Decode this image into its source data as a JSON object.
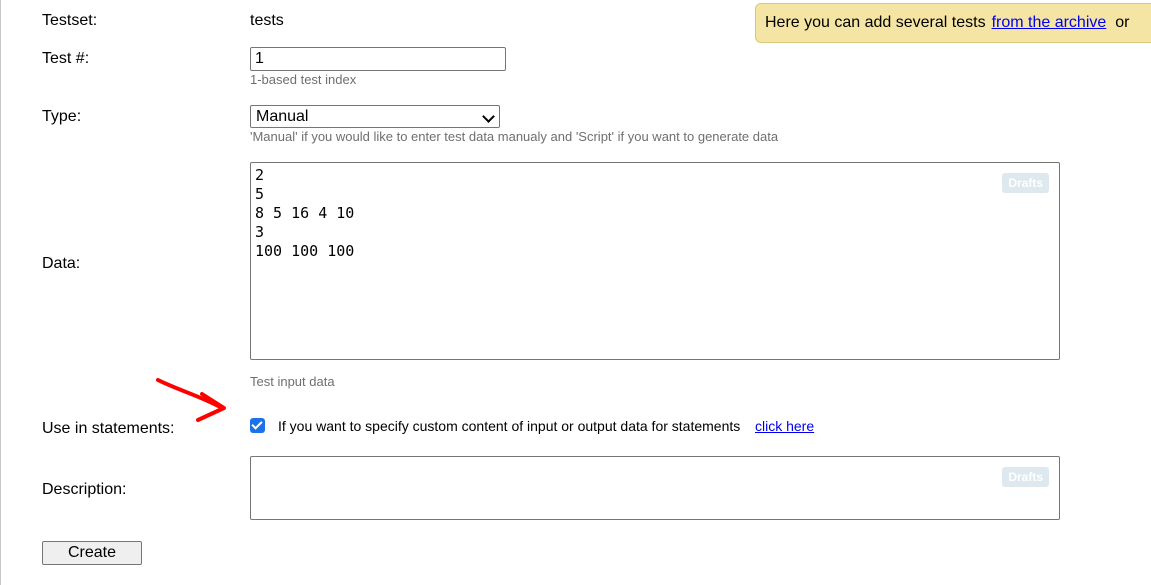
{
  "fields": {
    "testset": {
      "label": "Testset:",
      "value": "tests"
    },
    "test_number": {
      "label": "Test #:",
      "value": "1",
      "hint": "1-based test index"
    },
    "type": {
      "label": "Type:",
      "selected": "Manual",
      "hint": "'Manual' if you would like to enter test data manualy and 'Script' if you want to generate data"
    },
    "data": {
      "label": "Data:",
      "lines": [
        "2",
        "5",
        "8 5 16 4 10",
        "3",
        "100 100 100"
      ],
      "drafts_label": "Drafts",
      "hint": "Test input data"
    },
    "use_in_statements": {
      "label": "Use in statements:",
      "checked": true,
      "text": "If you want to specify custom content of input or output data for statements",
      "link": "click here"
    },
    "description": {
      "label": "Description:",
      "drafts_label": "Drafts"
    }
  },
  "notice": {
    "text": "Here you can add several tests",
    "link": "from the archive",
    "trailing": "or"
  },
  "buttons": {
    "create": "Create"
  },
  "colors": {
    "notice_bg": "#f5e5a4",
    "link": "#0000ee",
    "checkbox": "#1a73e8",
    "annotation_arrow": "#ff0000"
  }
}
